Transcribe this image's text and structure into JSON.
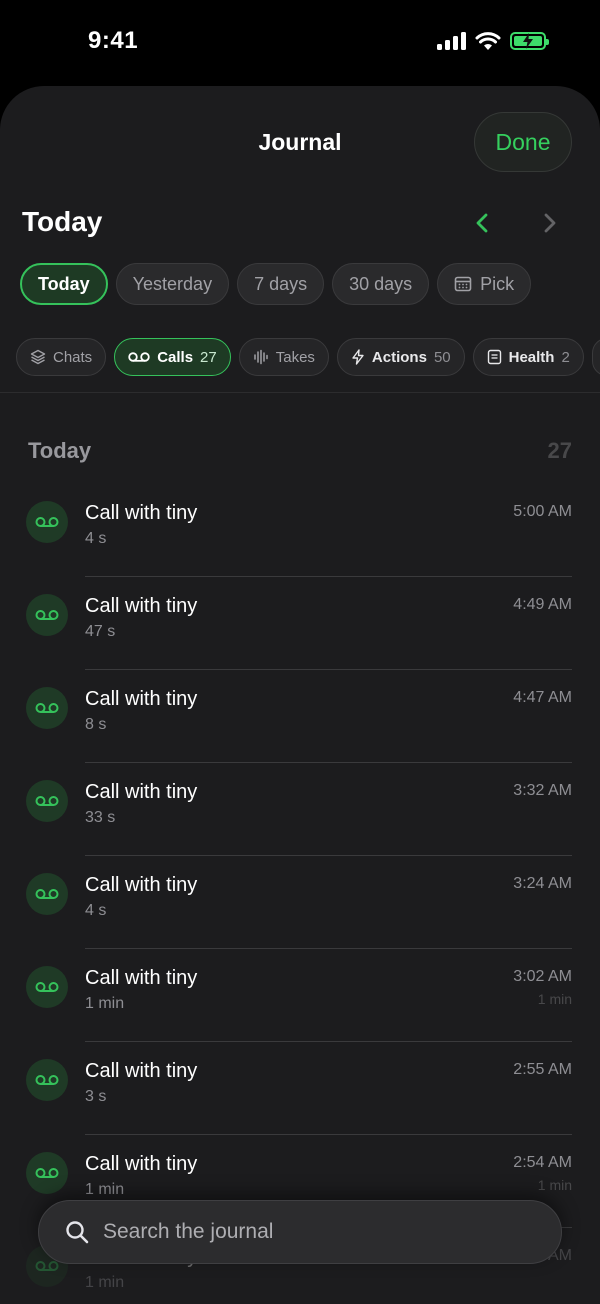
{
  "status_bar": {
    "time": "9:41"
  },
  "header": {
    "title": "Journal",
    "done_label": "Done"
  },
  "date_nav": {
    "heading": "Today"
  },
  "range_chips": [
    {
      "label": "Today",
      "active": true
    },
    {
      "label": "Yesterday",
      "active": false
    },
    {
      "label": "7 days",
      "active": false
    },
    {
      "label": "30 days",
      "active": false
    },
    {
      "label": "Pick",
      "active": false,
      "icon": "calendar-icon"
    }
  ],
  "filter_chips": [
    {
      "label": "Chats",
      "count": "",
      "icon": "layers-icon",
      "active": false
    },
    {
      "label": "Calls",
      "count": "27",
      "icon": "voicemail-icon",
      "active": true
    },
    {
      "label": "Takes",
      "count": "",
      "icon": "waveform-icon",
      "active": false
    },
    {
      "label": "Actions",
      "count": "50",
      "icon": "bolt-icon",
      "active": false
    },
    {
      "label": "Health",
      "count": "2",
      "icon": "clipboard-icon",
      "active": false
    }
  ],
  "section": {
    "title": "Today",
    "count": "27"
  },
  "entries": [
    {
      "title": "Call with tiny",
      "duration": "4 s",
      "time": "5:00 AM",
      "time_sub": ""
    },
    {
      "title": "Call with tiny",
      "duration": "47 s",
      "time": "4:49 AM",
      "time_sub": ""
    },
    {
      "title": "Call with tiny",
      "duration": "8 s",
      "time": "4:47 AM",
      "time_sub": ""
    },
    {
      "title": "Call with tiny",
      "duration": "33 s",
      "time": "3:32 AM",
      "time_sub": ""
    },
    {
      "title": "Call with tiny",
      "duration": "4 s",
      "time": "3:24 AM",
      "time_sub": ""
    },
    {
      "title": "Call with tiny",
      "duration": "1 min",
      "time": "3:02 AM",
      "time_sub": "1 min"
    },
    {
      "title": "Call with tiny",
      "duration": "3 s",
      "time": "2:55 AM",
      "time_sub": ""
    },
    {
      "title": "Call with tiny",
      "duration": "1 min",
      "time": "2:54 AM",
      "time_sub": "1 min"
    },
    {
      "title": "Call with tiny",
      "duration": "1 min",
      "time": "2:52 AM",
      "time_sub": ""
    }
  ],
  "search": {
    "placeholder": "Search the journal"
  },
  "colors": {
    "accent": "#35c25b",
    "background": "#1c1c1e"
  }
}
